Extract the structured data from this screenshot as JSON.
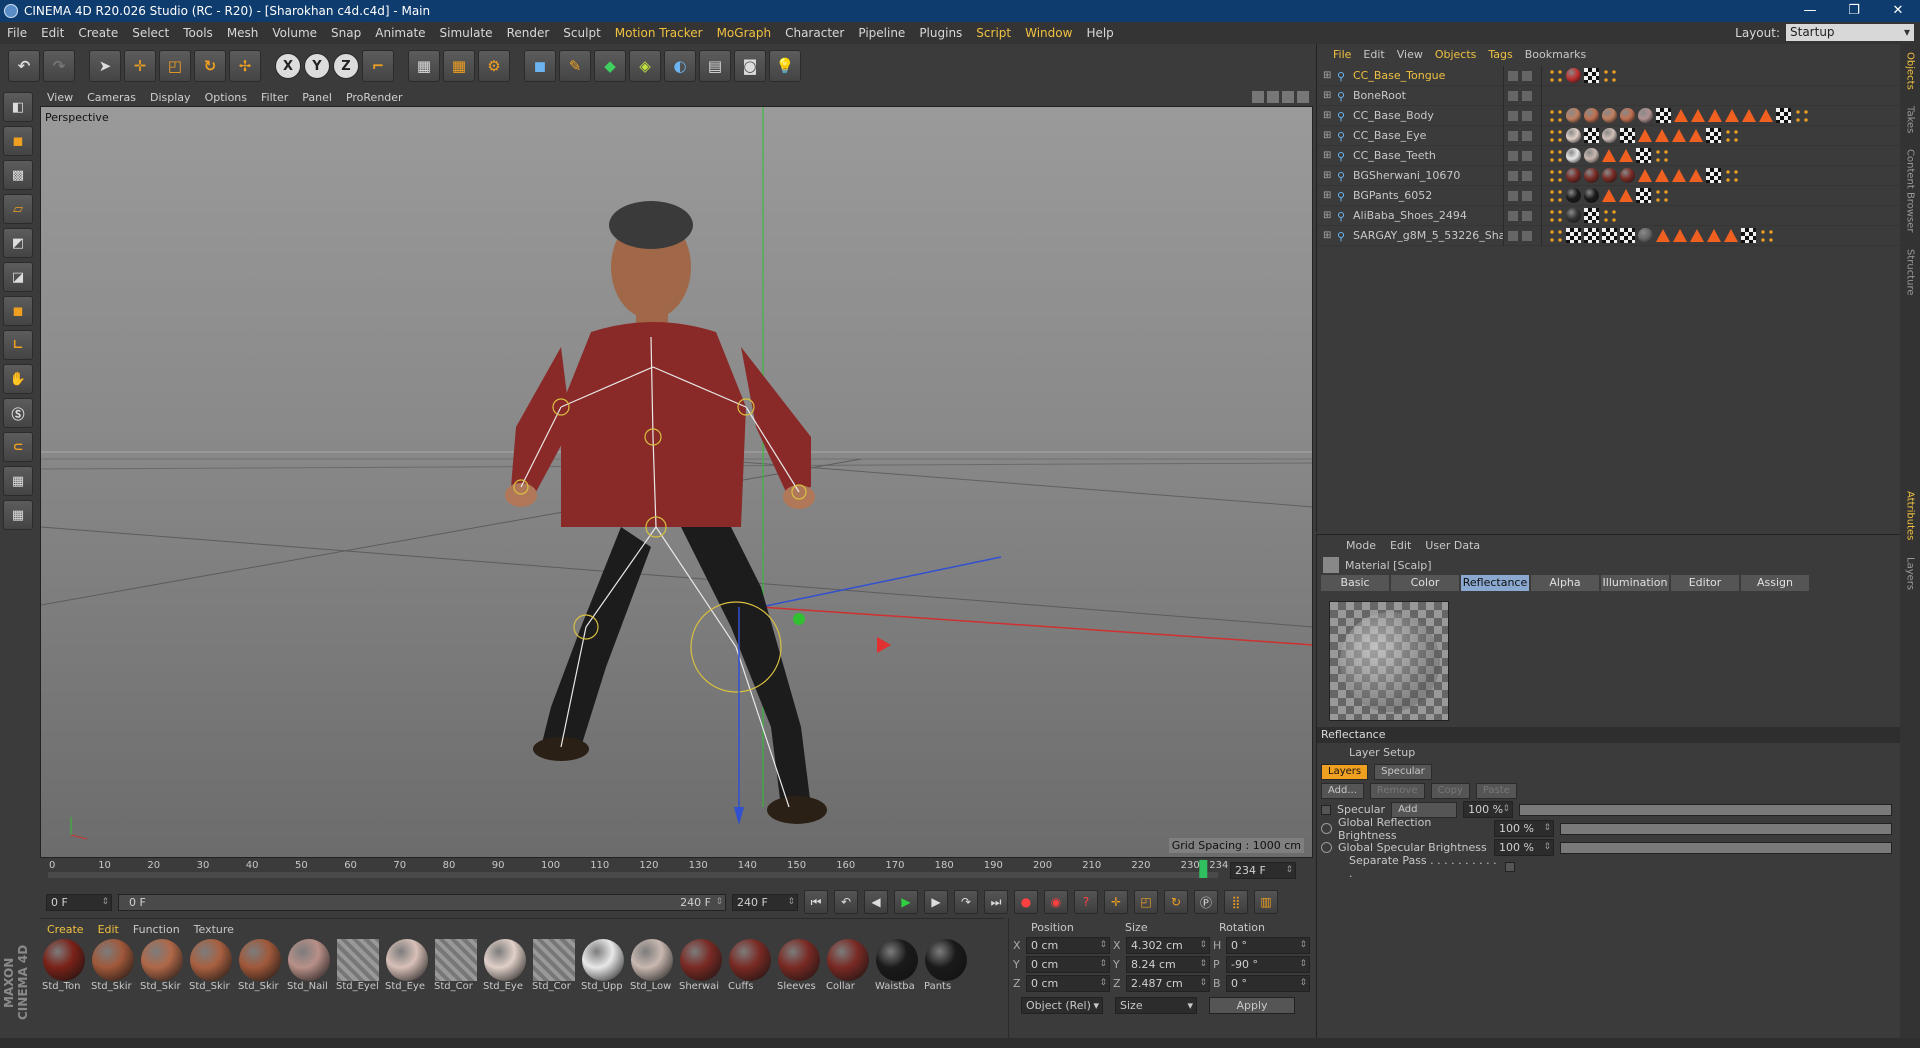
{
  "window": {
    "title": "CINEMA 4D R20.026 Studio (RC - R20) - [Sharokhan c4d.c4d] - Main"
  },
  "menubar": {
    "items": [
      "File",
      "Edit",
      "Create",
      "Select",
      "Tools",
      "Mesh",
      "Volume",
      "Snap",
      "Animate",
      "Simulate",
      "Render",
      "Sculpt",
      "Motion Tracker",
      "MoGraph",
      "Character",
      "Pipeline",
      "Plugins",
      "Script",
      "Window",
      "Help"
    ],
    "layout_label": "Layout:",
    "layout_value": "Startup"
  },
  "toolbar": {
    "axes": [
      "X",
      "Y",
      "Z"
    ]
  },
  "viewport": {
    "menu": [
      "View",
      "Cameras",
      "Display",
      "Options",
      "Filter",
      "Panel",
      "ProRender"
    ],
    "label": "Perspective",
    "grid_spacing": "Grid Spacing : 1000 cm"
  },
  "timeline": {
    "ticks": [
      "0",
      "10",
      "20",
      "30",
      "40",
      "50",
      "60",
      "70",
      "80",
      "90",
      "100",
      "110",
      "120",
      "130",
      "140",
      "150",
      "160",
      "170",
      "180",
      "190",
      "200",
      "210",
      "220",
      "230",
      "234"
    ],
    "current_frame_field": "234 F",
    "current_frame": 234
  },
  "playbar": {
    "start": "0 F",
    "range_start": "0 F",
    "range_end": "240 F",
    "end": "240 F"
  },
  "materials": {
    "menu": [
      "Create",
      "Edit",
      "Function",
      "Texture"
    ],
    "items": [
      {
        "name": "Std_Ton",
        "color": "#7a2218"
      },
      {
        "name": "Std_Skir",
        "color": "#a0583a"
      },
      {
        "name": "Std_Skir",
        "color": "#b06848"
      },
      {
        "name": "Std_Skir",
        "color": "#a86040"
      },
      {
        "name": "Std_Skir",
        "color": "#a0583a"
      },
      {
        "name": "Std_Nail",
        "color": "#b89088"
      },
      {
        "name": "Std_Eyel",
        "color": "flat"
      },
      {
        "name": "Std_Eye",
        "color": "#d8c0b8"
      },
      {
        "name": "Std_Cor",
        "color": "flat"
      },
      {
        "name": "Std_Eye",
        "color": "#e0d0c8"
      },
      {
        "name": "Std_Cor",
        "color": "flat"
      },
      {
        "name": "Std_Upp",
        "color": "#e8e8e8"
      },
      {
        "name": "Std_Low",
        "color": "#c8b8b0"
      },
      {
        "name": "Sherwai",
        "color": "#7a2a24"
      },
      {
        "name": "Cuffs",
        "color": "#7a2a24"
      },
      {
        "name": "Sleeves",
        "color": "#7a2a24"
      },
      {
        "name": "Collar",
        "color": "#7a2a24"
      },
      {
        "name": "Waistba",
        "color": "#1a1a1a"
      },
      {
        "name": "Pants",
        "color": "#1a1a1a"
      }
    ]
  },
  "coords": {
    "headers": [
      "Position",
      "Size",
      "Rotation"
    ],
    "rows": [
      {
        "axis": "X",
        "pos": "0 cm",
        "saxis": "X",
        "size": "4.302 cm",
        "raxis": "H",
        "rot": "0 °"
      },
      {
        "axis": "Y",
        "pos": "0 cm",
        "saxis": "Y",
        "size": "8.24 cm",
        "raxis": "P",
        "rot": "-90 °"
      },
      {
        "axis": "Z",
        "pos": "0 cm",
        "saxis": "Z",
        "size": "2.487 cm",
        "raxis": "B",
        "rot": "0 °"
      }
    ],
    "mode": "Object (Rel)",
    "size_mode": "Size",
    "apply": "Apply"
  },
  "objects": {
    "menu": [
      "File",
      "Edit",
      "View",
      "Objects",
      "Tags",
      "Bookmarks"
    ],
    "rows": [
      {
        "name": "CC_Base_Tongue",
        "hl": true,
        "tags": [
          "dots",
          "ball:#c03030",
          "chk",
          "dots"
        ]
      },
      {
        "name": "BoneRoot",
        "hl": false,
        "tags": []
      },
      {
        "name": "CC_Base_Body",
        "hl": false,
        "tags": [
          "dots",
          "ball:#c08060",
          "ball:#c07050",
          "ball:#c08060",
          "ball:#c07050",
          "ball:#b09090",
          "chk",
          "tri",
          "tri",
          "tri",
          "tri",
          "tri",
          "tri",
          "chk",
          "dots"
        ]
      },
      {
        "name": "CC_Base_Eye",
        "hl": false,
        "tags": [
          "dots",
          "ball:#e0d0c8",
          "chk",
          "ball:#d0c0b8",
          "chk",
          "tri",
          "tri",
          "tri",
          "tri",
          "chk",
          "dots"
        ]
      },
      {
        "name": "CC_Base_Teeth",
        "hl": false,
        "tags": [
          "dots",
          "ball:#e8e8e8",
          "ball:#c8b8b0",
          "tri",
          "tri",
          "chk",
          "dots"
        ]
      },
      {
        "name": "BGSherwani_10670",
        "hl": false,
        "tags": [
          "dots",
          "ball:#7a2a24",
          "ball:#7a2a24",
          "ball:#7a2a24",
          "ball:#7a2a24",
          "tri",
          "tri",
          "tri",
          "tri",
          "chk",
          "dots"
        ]
      },
      {
        "name": "BGPants_6052",
        "hl": false,
        "tags": [
          "dots",
          "ball:#1a1a1a",
          "ball:#1a1a1a",
          "tri",
          "tri",
          "chk",
          "dots"
        ]
      },
      {
        "name": "AliBaba_Shoes_2494",
        "hl": false,
        "tags": [
          "dots",
          "ball:#333",
          "chk",
          "dots"
        ]
      },
      {
        "name": "SARGAY_g8M_5_53226_Shape",
        "hl": false,
        "tags": [
          "dots",
          "chk",
          "chk",
          "chk",
          "chk",
          "ball:#666",
          "tri",
          "tri",
          "tri",
          "tri",
          "tri",
          "chk",
          "dots"
        ]
      }
    ]
  },
  "right_tabs": [
    "Objects",
    "Takes",
    "Content Browser",
    "Structure",
    "Attributes",
    "Layers"
  ],
  "attributes": {
    "menu": [
      "Mode",
      "Edit",
      "User Data"
    ],
    "title": "Material [Scalp]",
    "tabs": [
      "Basic",
      "Color",
      "Reflectance",
      "Alpha",
      "Illumination",
      "Editor",
      "Assign"
    ],
    "active_tab": "Reflectance",
    "section": "Reflectance",
    "layer_setup": "Layer Setup",
    "layer_tabs": [
      "Layers",
      "Specular"
    ],
    "buttons": [
      "Add...",
      "Remove",
      "Copy",
      "Paste"
    ],
    "specular_label": "Specular",
    "specular_mode": "Add",
    "specular_value": "100 %",
    "global_reflection_label": "Global Reflection Brightness",
    "global_reflection_value": "100 %",
    "global_specular_label": "Global Specular Brightness",
    "global_specular_value": "100 %",
    "separate_pass_label": "Separate Pass . . . . . . . . . . ."
  },
  "branding": {
    "maxon": "MAXON CINEMA 4D"
  }
}
